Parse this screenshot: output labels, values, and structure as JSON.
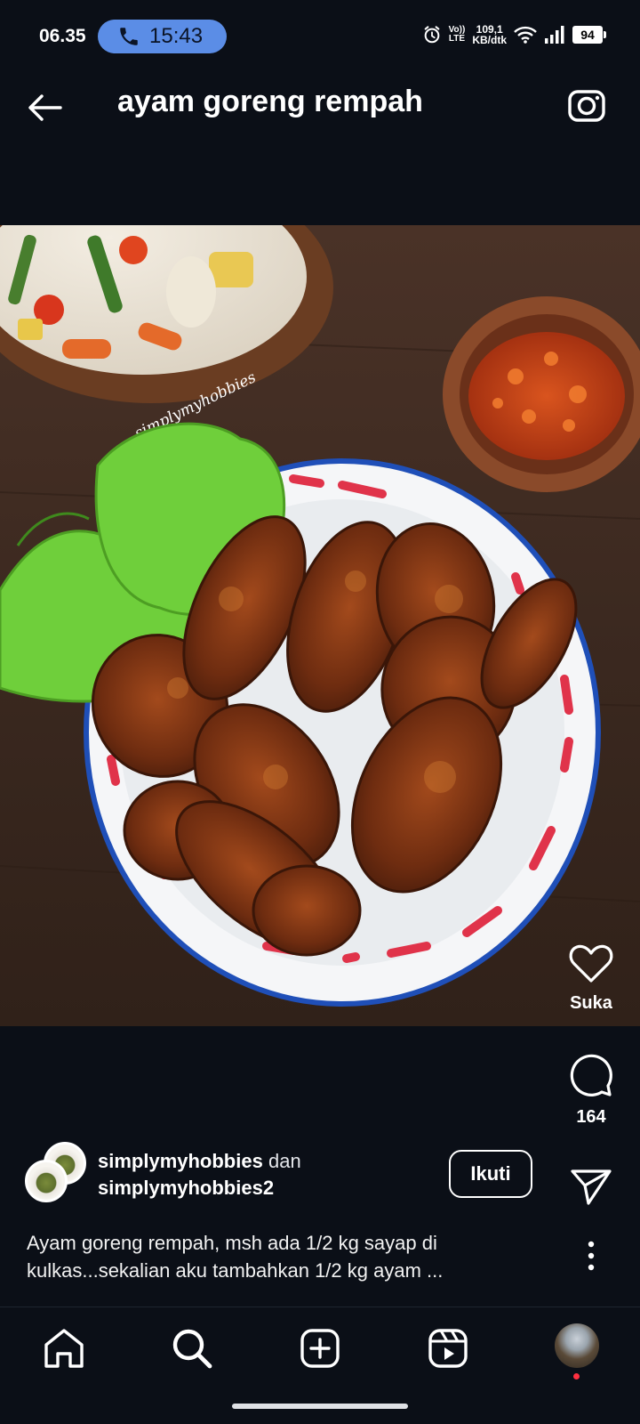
{
  "status_bar": {
    "time": "06.35",
    "call_time": "15:43",
    "network_label_1": "Vo))",
    "network_label_2": "LTE",
    "speed_value": "109,1",
    "speed_unit": "KB/dtk",
    "battery": "94"
  },
  "header": {
    "title": "ayam goreng rempah"
  },
  "post": {
    "watermark": "simplymyhobbies",
    "like_label": "Suka",
    "comment_count": "164",
    "author_1": "simplymyhobbies",
    "connector": "dan",
    "author_2": "simplymyhobbies2",
    "follow_label": "Ikuti",
    "caption_line_1": "Ayam goreng rempah, msh ada 1/2 kg sayap di",
    "caption_line_2": "kulkas...sekalian aku tambahkan 1/2 kg ayam ..."
  },
  "nav": {
    "items": [
      "home-icon",
      "search-icon",
      "create-icon",
      "reels-icon",
      "profile-avatar"
    ]
  },
  "colors": {
    "background": "#0b0f17",
    "call_pill": "#5b8de6",
    "notification_dot": "#ff3040"
  }
}
